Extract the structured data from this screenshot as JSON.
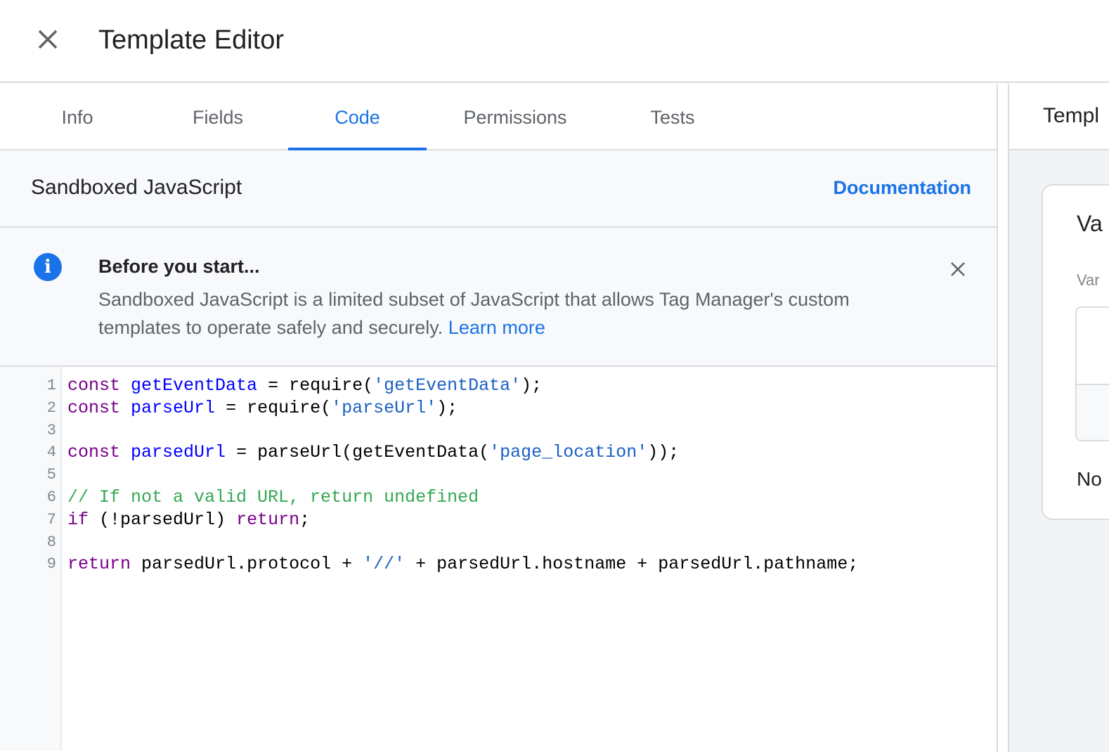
{
  "header": {
    "title": "Template Editor",
    "close_icon": "close-icon"
  },
  "tabs": [
    {
      "label": "Info"
    },
    {
      "label": "Fields"
    },
    {
      "label": "Code",
      "active": true
    },
    {
      "label": "Permissions"
    },
    {
      "label": "Tests"
    }
  ],
  "section": {
    "title": "Sandboxed JavaScript",
    "documentation_link": "Documentation"
  },
  "notice": {
    "icon": "info-icon",
    "title": "Before you start...",
    "body": "Sandboxed JavaScript is a limited subset of JavaScript that allows Tag Manager's custom templates to operate safely and securely.",
    "link": "Learn more"
  },
  "code": {
    "line_numbers": [
      "1",
      "2",
      "3",
      "4",
      "5",
      "6",
      "7",
      "8",
      "9"
    ],
    "lines": [
      "const getEventData = require('getEventData');",
      "const parseUrl = require('parseUrl');",
      "",
      "const parsedUrl = parseUrl(getEventData('page_location'));",
      "",
      "// If not a valid URL, return undefined",
      "if (!parsedUrl) return;",
      "",
      "return parsedUrl.protocol + '//' + parsedUrl.hostname + parsedUrl.pathname;"
    ]
  },
  "preview": {
    "title": "Templ",
    "card_title": "Va",
    "card_label": "Var",
    "card_footer": "No"
  },
  "colors": {
    "accent": "#1a73e8",
    "keyword": "#770088",
    "definition": "#0000ff",
    "string": "#1a5fc4",
    "comment": "#34a853"
  }
}
